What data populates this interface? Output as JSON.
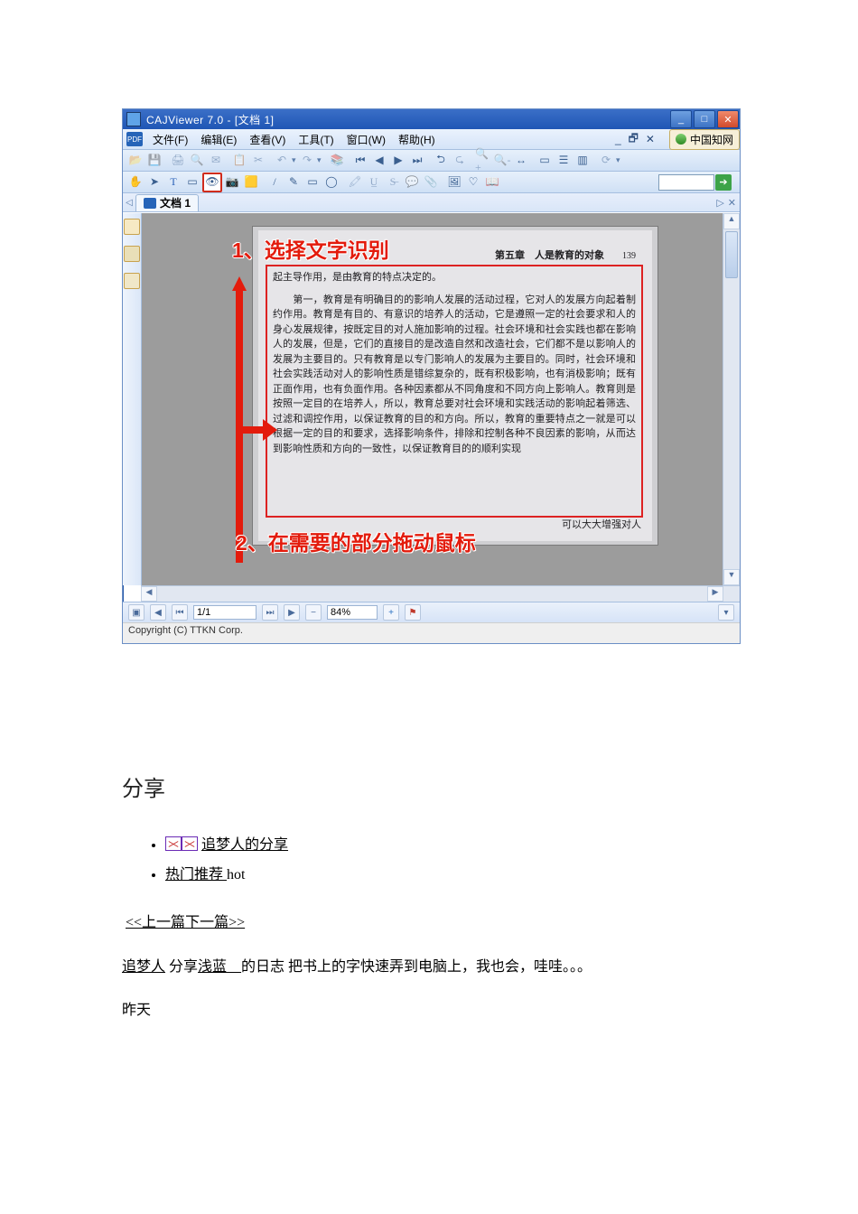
{
  "app": {
    "title": "CAJViewer 7.0 - [文档 1]",
    "menus": {
      "file": "文件(F)",
      "edit": "编辑(E)",
      "view": "查看(V)",
      "tools": "工具(T)",
      "window": "窗口(W)",
      "help": "帮助(H)"
    },
    "cnki_label": "中国知网",
    "doc_tab": "文档 1",
    "page_field": "1/1",
    "zoom": "84%",
    "copyright": "Copyright (C) TTKN Corp."
  },
  "doc": {
    "chapter": "第五章　人是教育的对象",
    "pagenum": "139",
    "line1": "起主导作用，是由教育的特点决定的。",
    "body": "　　第一，教育是有明确目的的影响人发展的活动过程，它对人的发展方向起着制约作用。教育是有目的、有意识的培养人的活动，它是遵照一定的社会要求和人的身心发展规律，按既定目的对人施加影响的过程。社会环境和社会实践也都在影响人的发展，但是，它们的直接目的是改造自然和改造社会，它们都不是以影响人的发展为主要目的。只有教育是以专门影响人的发展为主要目的。同时，社会环境和社会实践活动对人的影响性质是错综复杂的，既有积极影响，也有消极影响；既有正面作用，也有负面作用。各种因素都从不同角度和不同方向上影响人。教育则是按照一定目的在培养人，所以，教育总要对社会环境和实践活动的影响起着筛选、过滤和调控作用，以保证教育的目的和方向。所以，教育的重要特点之一就是可以根据一定的目的和要求，选择影响条件，排除和控制各种不良因素的影响，从而达到影响性质和方向的一致性，以保证教育目的的顺利实现",
    "tail": "可以大大增强对人"
  },
  "overlay": {
    "step1_num": "1、",
    "step1": "选择文字识别",
    "step2_num": "2、",
    "step2": "在需要的部分拖动鼠标"
  },
  "article": {
    "heading": "分享",
    "li1": "追梦人的分享",
    "li2_a": "热门推荐 ",
    "li2_b": "hot",
    "prev": "<<上一篇",
    "next": "下一篇>>",
    "share_author": "追梦人",
    "share_mid1": " 分享",
    "share_source": "浅蓝　",
    "share_mid2": "的日志 把书上的字快速弄到电脑上，我也会，哇哇。。。",
    "time": "昨天"
  }
}
